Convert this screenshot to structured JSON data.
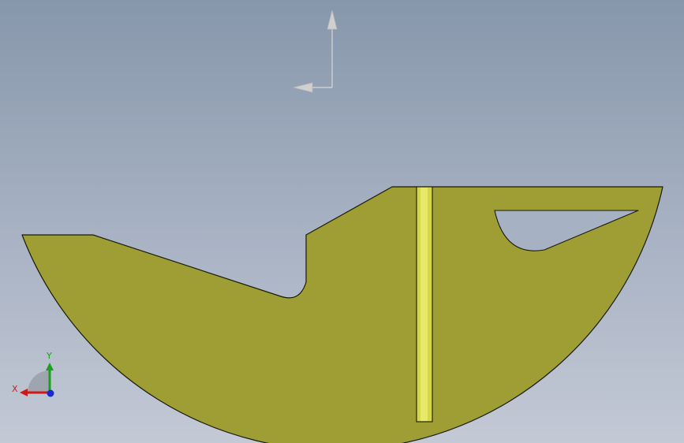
{
  "viewport": {
    "background_top": "#8797ab",
    "background_bottom": "#c3c9d5"
  },
  "part": {
    "face_color": "#9e9e35",
    "edge_color": "#1a1a0a",
    "slot_color": "#d6d64a",
    "slot_highlight": "#e8e86a",
    "hole_color": "#a6b1c3"
  },
  "sketch_axes": {
    "icon": "sketch-origin-arrows",
    "color": "#d8d8d8"
  },
  "triad": {
    "icon": "view-orientation-triad",
    "x_label": "X",
    "y_label": "Y",
    "x_color": "#cc1a1a",
    "y_color": "#1aa01a",
    "z_color": "#1a2ad0"
  }
}
